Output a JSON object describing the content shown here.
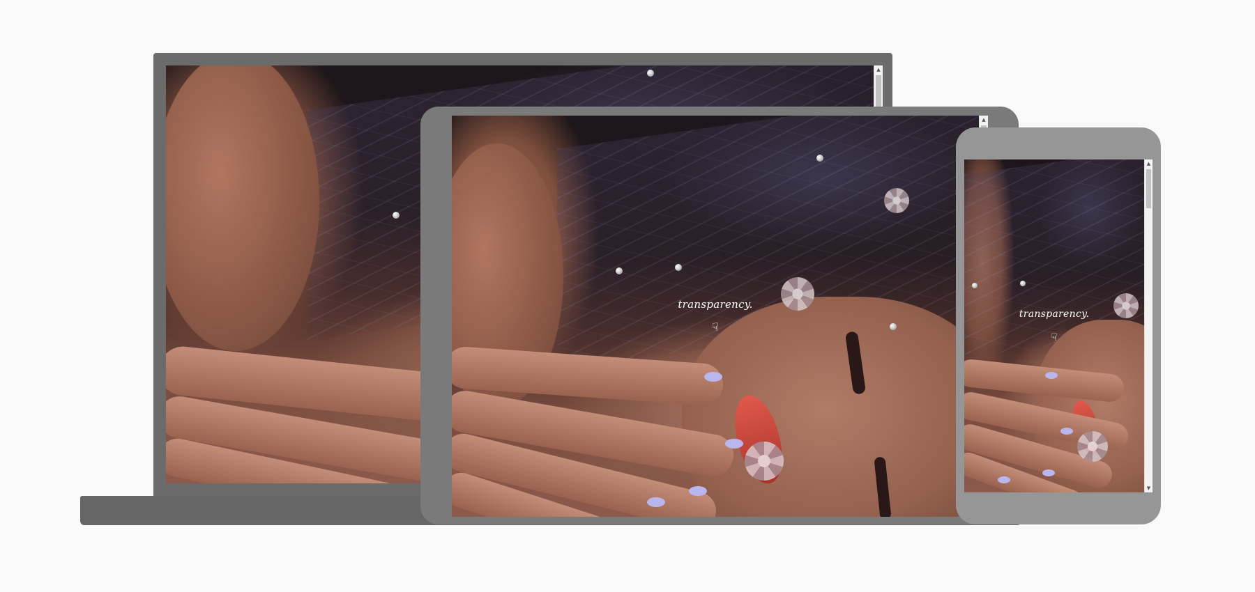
{
  "site": {
    "tagline": "transparency.",
    "pointer_glyph": "☟",
    "pointer_icon": "hand-pointing-down-icon"
  },
  "scrollbar": {
    "up_arrow": "▲",
    "down_arrow": "▼"
  },
  "colors": {
    "page_background": "#f9f9f9",
    "laptop_frame": "#6b6b6b",
    "tablet_frame": "#7a7a7a",
    "phone_frame": "#969696",
    "tagline_text": "#ffffff",
    "nail_polish": "#b9b6ee"
  }
}
